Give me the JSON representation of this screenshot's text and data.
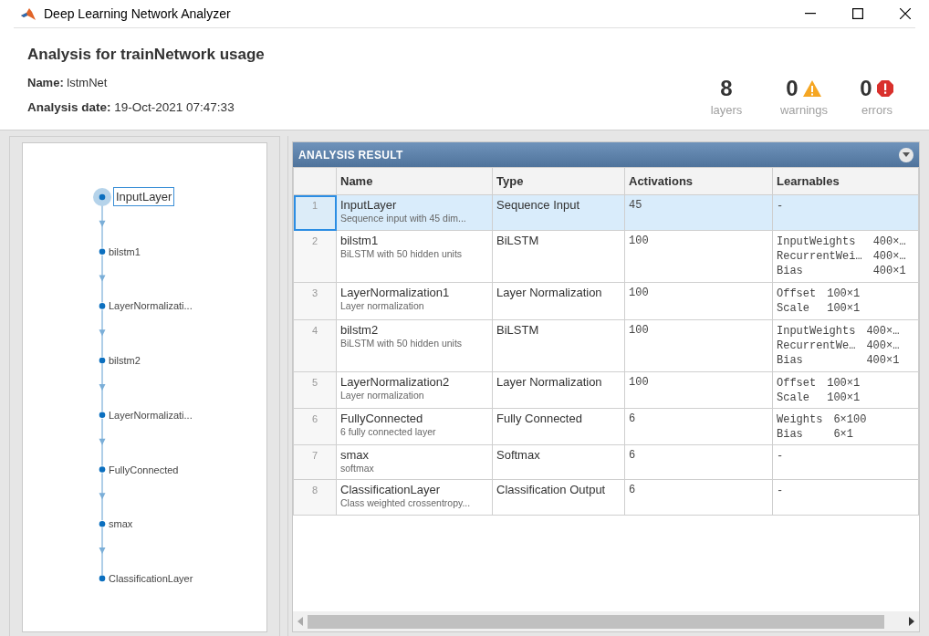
{
  "window": {
    "title": "Deep Learning Network Analyzer"
  },
  "header": {
    "title": "Analysis for trainNetwork usage",
    "name_label": "Name:",
    "name_value": "lstmNet",
    "date_label": "Analysis date:",
    "date_value": "19-Oct-2021 07:47:33"
  },
  "summary": [
    {
      "kind": "plain",
      "value": "8",
      "label": "layers"
    },
    {
      "kind": "warning",
      "value": "0",
      "label": "warnings"
    },
    {
      "kind": "error",
      "value": "0",
      "label": "errors"
    }
  ],
  "graph": {
    "nodes": [
      {
        "label": "InputLayer",
        "selected": true
      },
      {
        "label": "bilstm1",
        "selected": false
      },
      {
        "label": "LayerNormalizati...",
        "selected": false
      },
      {
        "label": "bilstm2",
        "selected": false
      },
      {
        "label": "LayerNormalizati...",
        "selected": false
      },
      {
        "label": "FullyConnected",
        "selected": false
      },
      {
        "label": "smax",
        "selected": false
      },
      {
        "label": "ClassificationLayer",
        "selected": false
      }
    ]
  },
  "table": {
    "title": "ANALYSIS RESULT",
    "columns": [
      "Name",
      "Type",
      "Activations",
      "Learnables"
    ],
    "rows": [
      {
        "index": "1",
        "name": "InputLayer",
        "description": "Sequence input with 45 dim...",
        "type": "Sequence Input",
        "activations": "45",
        "learnables": [
          {
            "name": "-"
          }
        ],
        "selected": true
      },
      {
        "index": "2",
        "name": "bilstm1",
        "description": "BiLSTM with 50 hidden units",
        "type": "BiLSTM",
        "activations": "100",
        "learnables": [
          {
            "name": "InputWeights",
            "value": "400×…"
          },
          {
            "name": "RecurrentWei…",
            "value": "400×…"
          },
          {
            "name": "Bias",
            "value": "400×1"
          }
        ],
        "selected": false
      },
      {
        "index": "3",
        "name": "LayerNormalization1",
        "description": "Layer normalization",
        "type": "Layer Normalization",
        "activations": "100",
        "learnables": [
          {
            "name": "Offset",
            "value": "100×1"
          },
          {
            "name": "Scale",
            "value": "100×1"
          }
        ],
        "selected": false
      },
      {
        "index": "4",
        "name": "bilstm2",
        "description": "BiLSTM with 50 hidden units",
        "type": "BiLSTM",
        "activations": "100",
        "learnables": [
          {
            "name": "InputWeights",
            "value": "400×…"
          },
          {
            "name": "RecurrentWe…",
            "value": "400×…"
          },
          {
            "name": "Bias",
            "value": "400×1"
          }
        ],
        "selected": false
      },
      {
        "index": "5",
        "name": "LayerNormalization2",
        "description": "Layer normalization",
        "type": "Layer Normalization",
        "activations": "100",
        "learnables": [
          {
            "name": "Offset",
            "value": "100×1"
          },
          {
            "name": "Scale",
            "value": "100×1"
          }
        ],
        "selected": false
      },
      {
        "index": "6",
        "name": "FullyConnected",
        "description": "6 fully connected layer",
        "type": "Fully Connected",
        "activations": "6",
        "learnables": [
          {
            "name": "Weights",
            "value": "6×100"
          },
          {
            "name": "Bias",
            "value": "6×1"
          }
        ],
        "selected": false
      },
      {
        "index": "7",
        "name": "smax",
        "description": "softmax",
        "type": "Softmax",
        "activations": "6",
        "learnables": [
          {
            "name": "-"
          }
        ],
        "selected": false
      },
      {
        "index": "8",
        "name": "ClassificationLayer",
        "description": "Class weighted crossentropy...",
        "type": "Classification Output",
        "activations": "6",
        "learnables": [
          {
            "name": "-"
          }
        ],
        "selected": false
      }
    ]
  }
}
